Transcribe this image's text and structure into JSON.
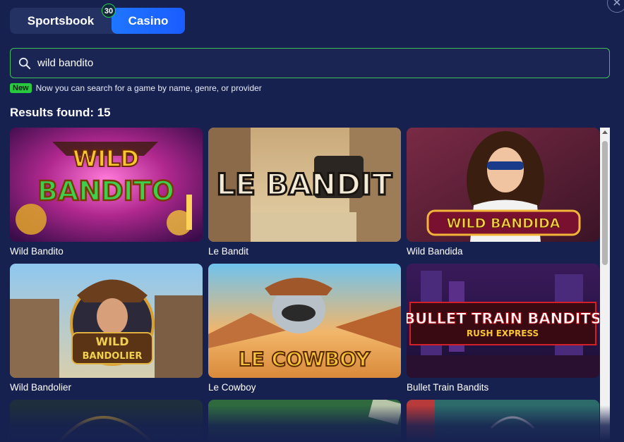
{
  "tabs": {
    "sportsbook": "Sportsbook",
    "casino": "Casino",
    "badge": "30"
  },
  "search": {
    "value": "wild bandito",
    "icon": "search-icon"
  },
  "hint": {
    "tag": "New",
    "text": "Now you can search for a game by name, genre, or provider"
  },
  "results": {
    "label": "Results found: 15"
  },
  "games": [
    {
      "title": "Wild Bandito",
      "logo": [
        "WILD",
        "BANDITO"
      ]
    },
    {
      "title": "Le Bandit",
      "logo": [
        "LE BANDIT"
      ]
    },
    {
      "title": "Wild Bandida",
      "logo": [
        "WILD BANDIDA"
      ]
    },
    {
      "title": "Wild Bandolier",
      "logo": [
        "WILD",
        "BANDOLIER"
      ]
    },
    {
      "title": "Le Cowboy",
      "logo": [
        "LE COWBOY"
      ]
    },
    {
      "title": "Bullet Train Bandits",
      "logo": [
        "BULLET TRAIN BANDITS",
        "RUSH EXPRESS"
      ]
    }
  ],
  "colors": {
    "background": "#172150",
    "accent": "#1e76ff",
    "search_border": "#3fbf5c",
    "new_tag": "#27c93f"
  }
}
